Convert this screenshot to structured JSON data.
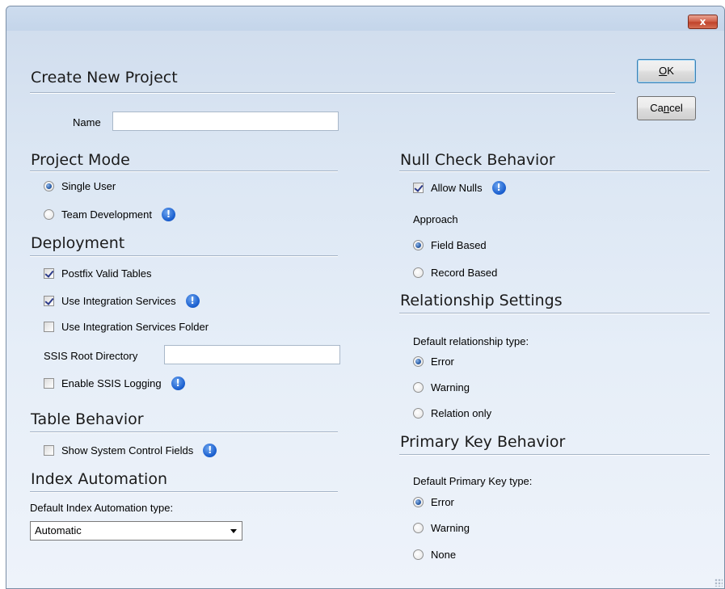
{
  "window": {
    "close_glyph": "x"
  },
  "buttons": {
    "ok": "OK",
    "ok_mnemonic": "O",
    "ok_rest": "K",
    "cancel_pre": "Ca",
    "cancel_mnemonic": "n",
    "cancel_rest": "cel"
  },
  "create": {
    "title": "Create New Project",
    "name_label": "Name",
    "name_value": ""
  },
  "project_mode": {
    "title": "Project Mode",
    "options": [
      {
        "label": "Single User",
        "selected": true
      },
      {
        "label": "Team Development",
        "selected": false
      }
    ]
  },
  "deployment": {
    "title": "Deployment",
    "postfix_valid_tables": {
      "label": "Postfix Valid Tables",
      "checked": true
    },
    "use_integration_services": {
      "label": "Use Integration Services",
      "checked": true
    },
    "use_integration_services_folder": {
      "label": "Use Integration Services Folder",
      "checked": false
    },
    "ssis_root_label": "SSIS Root Directory",
    "ssis_root_value": "",
    "enable_ssis_logging": {
      "label": "Enable SSIS Logging",
      "checked": false
    }
  },
  "table_behavior": {
    "title": "Table Behavior",
    "show_system_control_fields": {
      "label": "Show System Control Fields",
      "checked": false
    }
  },
  "index_automation": {
    "title": "Index Automation",
    "type_label": "Default Index Automation type:",
    "selected": "Automatic"
  },
  "null_check": {
    "title": "Null Check Behavior",
    "allow_nulls": {
      "label": "Allow Nulls",
      "checked": true
    },
    "approach_label": "Approach",
    "options": [
      {
        "label": "Field Based",
        "selected": true
      },
      {
        "label": "Record Based",
        "selected": false
      }
    ]
  },
  "relationship": {
    "title": "Relationship Settings",
    "type_label": "Default relationship type:",
    "options": [
      {
        "label": "Error",
        "selected": true
      },
      {
        "label": "Warning",
        "selected": false
      },
      {
        "label": "Relation only",
        "selected": false
      }
    ]
  },
  "primary_key": {
    "title": "Primary Key Behavior",
    "type_label": "Default Primary Key type:",
    "options": [
      {
        "label": "Error",
        "selected": true
      },
      {
        "label": "Warning",
        "selected": false
      },
      {
        "label": "None",
        "selected": false
      }
    ]
  },
  "icons": {
    "info": "info-icon",
    "close": "close-icon",
    "dropdown": "chevron-down-icon"
  },
  "colors": {
    "window_bg": "#dbe6f3",
    "close_red": "#c0442c",
    "info_blue": "#1b60d0"
  }
}
